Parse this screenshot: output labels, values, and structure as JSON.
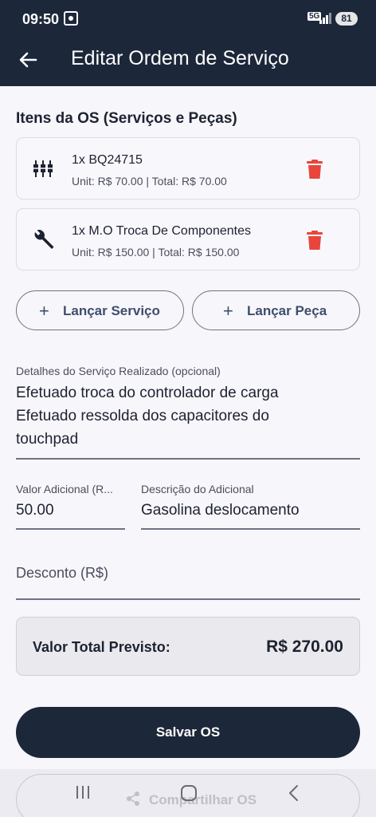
{
  "status_bar": {
    "time": "09:50",
    "network": "5G",
    "battery": "81"
  },
  "app_bar": {
    "back_icon": "arrow-left-icon",
    "title": "Editar Ordem de Serviço"
  },
  "items_section": {
    "title": "Itens da OS (Serviços e Peças)",
    "items": [
      {
        "icon": "component-icon",
        "name": "1x BQ24715",
        "price_line": "Unit: R$ 70.00 | Total: R$ 70.00",
        "delete_icon": "trash-icon"
      },
      {
        "icon": "wrench-icon",
        "name": "1x M.O Troca De Componentes",
        "price_line": "Unit: R$ 150.00 | Total: R$ 150.00",
        "delete_icon": "trash-icon"
      }
    ]
  },
  "actions": {
    "add_service_label": "Lançar Serviço",
    "add_part_label": "Lançar Peça"
  },
  "details": {
    "label": "Detalhes do Serviço Realizado (opcional)",
    "lines": [
      "Efetuado troca do controlador de carga",
      "Efetuado ressolda dos capacitores do",
      "touchpad"
    ]
  },
  "additional": {
    "value_label": "Valor Adicional (R...",
    "value": "50.00",
    "desc_label": "Descrição do Adicional",
    "desc": "Gasolina deslocamento"
  },
  "discount": {
    "placeholder": "Desconto (R$)"
  },
  "total": {
    "label": "Valor Total Previsto:",
    "value": "R$ 270.00"
  },
  "buttons": {
    "save": "Salvar OS",
    "share": "Compartilhar OS"
  },
  "colors": {
    "primary": "#1d273a",
    "delete": "#e8453c",
    "background": "#f7f6fb"
  }
}
